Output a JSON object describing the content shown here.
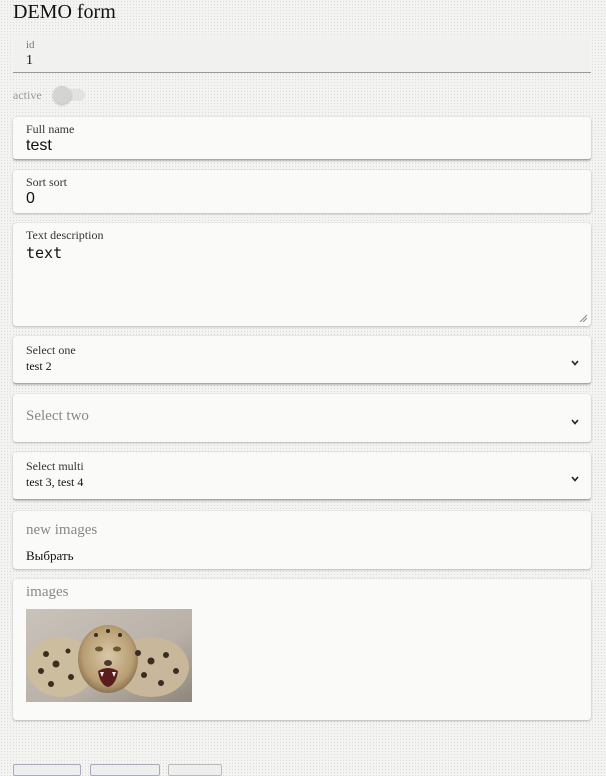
{
  "form": {
    "title": "DEMO form"
  },
  "fields": {
    "id": {
      "label": "id",
      "value": "1"
    },
    "active": {
      "label": "active"
    },
    "full_name": {
      "label": "Full name",
      "value": "test"
    },
    "sort": {
      "label": "Sort sort",
      "value": "0"
    },
    "text": {
      "label": "Text description",
      "value": "text"
    },
    "select_one": {
      "label": "Select one",
      "value": "test 2"
    },
    "select_two": {
      "placeholder": "Select two"
    },
    "select_multi": {
      "label": "Select multi",
      "value": "test 3, test 4"
    },
    "new_images": {
      "label": "new images",
      "button": "Выбрать"
    },
    "images": {
      "label": "images"
    }
  },
  "colors": {
    "accent": "#9ea3d6",
    "card": "#fafaf8"
  }
}
